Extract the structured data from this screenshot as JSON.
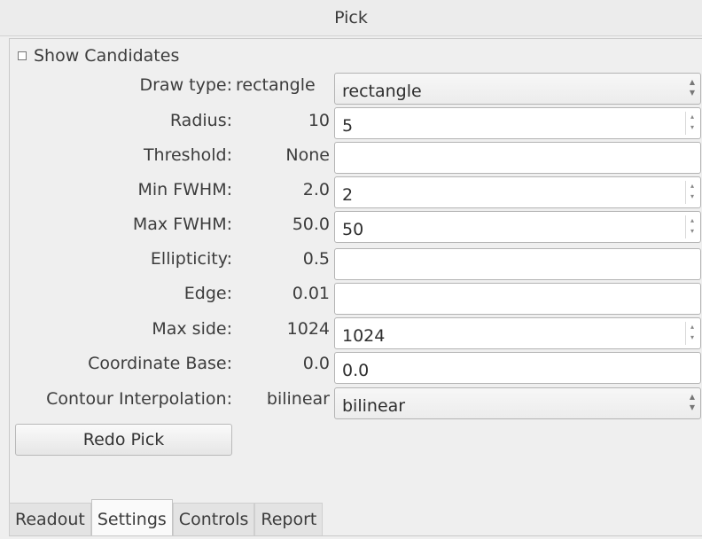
{
  "window": {
    "title": "Pick"
  },
  "show_candidates": {
    "label": "Show Candidates",
    "checked": false
  },
  "rows": [
    {
      "key": "draw_type",
      "label": "Draw type:",
      "value": "rectangle",
      "field": "rectangle",
      "kind": "combo"
    },
    {
      "key": "radius",
      "label": "Radius:",
      "value": "10",
      "field": "5",
      "kind": "spin"
    },
    {
      "key": "threshold",
      "label": "Threshold:",
      "value": "None",
      "field": "",
      "kind": "entry"
    },
    {
      "key": "min_fwhm",
      "label": "Min FWHM:",
      "value": "2.0",
      "field": "2",
      "kind": "spin"
    },
    {
      "key": "max_fwhm",
      "label": "Max FWHM:",
      "value": "50.0",
      "field": "50",
      "kind": "spin"
    },
    {
      "key": "ellipticity",
      "label": "Ellipticity:",
      "value": "0.5",
      "field": "",
      "kind": "entry"
    },
    {
      "key": "edge",
      "label": "Edge:",
      "value": "0.01",
      "field": "",
      "kind": "entry"
    },
    {
      "key": "max_side",
      "label": "Max side:",
      "value": "1024",
      "field": "1024",
      "kind": "spin"
    },
    {
      "key": "coord_base",
      "label": "Coordinate Base:",
      "value": "0.0",
      "field": "0.0",
      "kind": "entry"
    },
    {
      "key": "contour_interp",
      "label": "Contour Interpolation:",
      "value": "bilinear",
      "field": "bilinear",
      "kind": "combo"
    }
  ],
  "redo_button": {
    "label": "Redo Pick"
  },
  "tabs": [
    {
      "label": "Readout",
      "active": false
    },
    {
      "label": "Settings",
      "active": true
    },
    {
      "label": "Controls",
      "active": false
    },
    {
      "label": "Report",
      "active": false
    }
  ]
}
